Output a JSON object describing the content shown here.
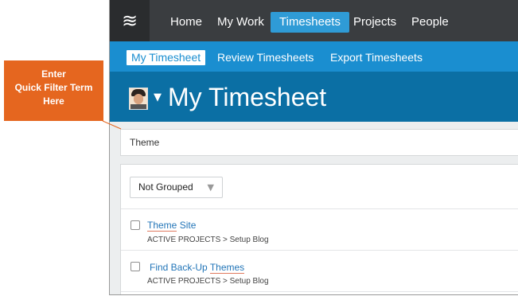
{
  "nav": {
    "logo_glyph": "≋",
    "items": [
      {
        "label": "Home"
      },
      {
        "label": "My Work"
      },
      {
        "label": "Timesheets",
        "active": true
      },
      {
        "label": "Projects"
      },
      {
        "label": "People"
      }
    ]
  },
  "subnav": {
    "items": [
      {
        "label": "My Timesheet",
        "active": true
      },
      {
        "label": "Review Timesheets"
      },
      {
        "label": "Export Timesheets"
      }
    ]
  },
  "header": {
    "title": "My Timesheet",
    "caret_glyph": "▼",
    "avatar_icon": "user-avatar"
  },
  "filter": {
    "value": "Theme"
  },
  "grouping": {
    "selected": "Not Grouped",
    "arrow_glyph": "▼"
  },
  "results": [
    {
      "name_pre": "",
      "name_match": "Theme",
      "name_post": " Site",
      "path": "ACTIVE PROJECTS > Setup Blog"
    },
    {
      "name_pre": "Find Back-Up ",
      "name_match": "Themes",
      "name_post": "",
      "path": "ACTIVE PROJECTS > Setup Blog"
    }
  ],
  "callout": {
    "line1": "Enter",
    "line2": "Quick Filter Term",
    "line3": "Here"
  },
  "colors": {
    "topnav": "#3a3d40",
    "subnav": "#1a8ed0",
    "titlebar": "#0b6fa4",
    "accent": "#2f9bd6",
    "callout": "#e5661f",
    "link": "#2275b8"
  }
}
